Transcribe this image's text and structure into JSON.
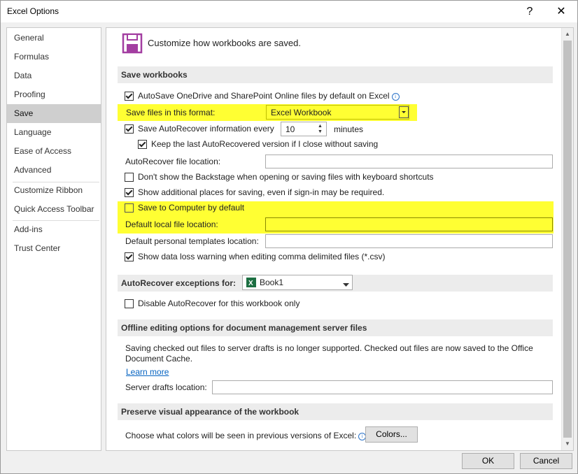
{
  "window": {
    "title": "Excel Options",
    "help": "?",
    "close": "✕"
  },
  "sidebar": {
    "items": [
      {
        "label": "General"
      },
      {
        "label": "Formulas"
      },
      {
        "label": "Data"
      },
      {
        "label": "Proofing"
      },
      {
        "label": "Save"
      },
      {
        "label": "Language"
      },
      {
        "label": "Ease of Access"
      },
      {
        "label": "Advanced"
      },
      {
        "label": "Customize Ribbon"
      },
      {
        "label": "Quick Access Toolbar"
      },
      {
        "label": "Add-ins"
      },
      {
        "label": "Trust Center"
      }
    ],
    "selected": "Save"
  },
  "header": {
    "text": "Customize how workbooks are saved."
  },
  "save": {
    "heading": "Save workbooks",
    "autosave_label": "AutoSave OneDrive and SharePoint Online files by default on Excel",
    "autosave_checked": true,
    "format_label": "Save files in this format:",
    "format_value": "Excel Workbook",
    "autorecover_label": "Save AutoRecover information every",
    "autorecover_checked": true,
    "autorecover_minutes": "10",
    "minutes_label": "minutes",
    "keep_label": "Keep the last AutoRecovered version if I close without saving",
    "keep_checked": true,
    "ar_location_label": "AutoRecover file location:",
    "ar_location_value": "",
    "backstage_label": "Don't show the Backstage when opening or saving files with keyboard shortcuts",
    "backstage_checked": false,
    "additional_label": "Show additional places for saving, even if sign-in may be required.",
    "additional_checked": true,
    "computer_label": "Save to Computer by default",
    "computer_checked": false,
    "default_local_label": "Default local file location:",
    "default_local_value": "",
    "templates_label": "Default personal templates location:",
    "templates_value": "",
    "dataloss_label": "Show data loss warning when editing comma delimited files (*.csv)",
    "dataloss_checked": true
  },
  "exceptions": {
    "heading": "AutoRecover exceptions for:",
    "workbook": "Book1",
    "disable_label": "Disable AutoRecover for this workbook only",
    "disable_checked": false
  },
  "offline": {
    "heading": "Offline editing options for document management server files",
    "desc_line1": "Saving checked out files to server drafts is no longer supported. Checked out files are now saved to the Office",
    "desc_line2": "Document Cache.",
    "learn_more": "Learn more",
    "drafts_label": "Server drafts location:",
    "drafts_value": ""
  },
  "preserve": {
    "heading": "Preserve visual appearance of the workbook",
    "colors_label": "Choose what colors will be seen in previous versions of Excel:",
    "colors_button": "Colors..."
  },
  "footer": {
    "ok": "OK",
    "cancel": "Cancel"
  },
  "colors": {
    "highlight": "#ffff33",
    "selected_nav": "#cfcfcf",
    "section_bg": "#ececec",
    "save_icon": "#a33ea1",
    "link": "#0563c1",
    "excel_green": "#1d6f42"
  }
}
